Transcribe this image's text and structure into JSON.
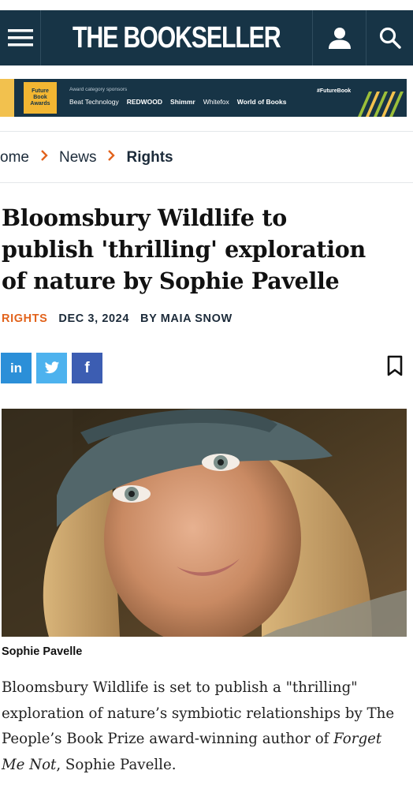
{
  "header": {
    "logo": "THE BOOKSELLER",
    "menu_icon": "hamburger-menu-icon",
    "account_icon": "user-icon",
    "search_icon": "search-icon"
  },
  "banner": {
    "badge_line1": "Future",
    "badge_line2": "Book",
    "badge_line3": "Awards",
    "sponsor_label": "Award category sponsors",
    "sponsors": [
      "Beat Technology",
      "REDWOOD",
      "Shimmr",
      "Whitefox",
      "World of Books"
    ],
    "hashtag": "#FutureBook"
  },
  "breadcrumb": {
    "items": [
      "ome",
      "News",
      "Rights"
    ]
  },
  "article": {
    "headline": "Bloomsbury Wildlife to publish 'thrilling' exploration of nature by Sophie Pavelle",
    "category": "RIGHTS",
    "date": "DEC 3, 2024",
    "author": "BY MAIA SNOW",
    "share": {
      "linkedin": "in",
      "facebook": "f"
    },
    "photo_caption": "Sophie Pavelle",
    "body_lead": "Bloomsbury Wildlife is set to publish a \"thrilling\" exploration of nature’s symbiotic relationships by The People’s Book Prize award-winning author of ",
    "body_title": "Forget Me Not",
    "body_tail": ", Sophie Pavelle."
  },
  "colors": {
    "brand_navy": "#173446",
    "accent_orange": "#e2631c",
    "linkedin": "#2b8fd8",
    "twitter": "#4db2ee",
    "facebook": "#3c5db2"
  }
}
